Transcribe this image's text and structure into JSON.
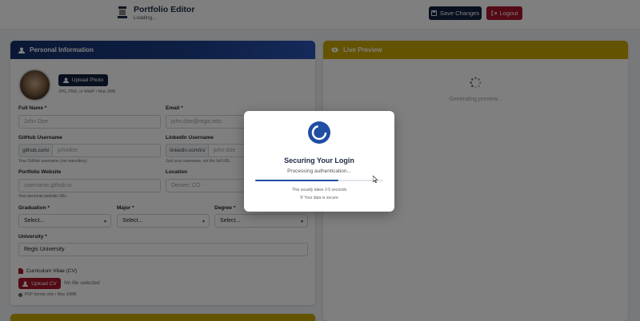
{
  "header": {
    "title": "Portfolio Editor",
    "subtitle": "Loading...",
    "save_label": "Save Changes",
    "logout_label": "Logout"
  },
  "personal": {
    "heading": "Personal Information",
    "upload_photo_label": "Upload Photo",
    "photo_hint": "JPG, PNG, or WebP • Max 2MB",
    "full_name": {
      "label": "Full Name *",
      "placeholder": "John Doe"
    },
    "email": {
      "label": "Email *",
      "placeholder": "john.doe@regis.edu"
    },
    "github": {
      "label": "GitHub Username",
      "prefix": "github.com/",
      "placeholder": "johndoe",
      "help": "Your GitHub username (not repository)"
    },
    "linkedin": {
      "label": "LinkedIn Username",
      "prefix": "linkedin.com/in/",
      "placeholder": "john-doe",
      "help": "Just your username, not the full URL"
    },
    "website": {
      "label": "Portfolio Website",
      "placeholder": "username.github.io",
      "help": "Your personal website URL"
    },
    "location": {
      "label": "Location",
      "placeholder": "Denver, CO"
    },
    "graduation": {
      "label": "Graduation *",
      "value": "Select..."
    },
    "major": {
      "label": "Major *",
      "value": "Select..."
    },
    "degree": {
      "label": "Degree *",
      "value": "Select..."
    },
    "university": {
      "label": "University *",
      "value": "Regis University"
    },
    "cv": {
      "label": "Curriculum Vitae (CV)",
      "button": "Upload CV",
      "status": "No file selected",
      "hint": "PDF format only • Max 10MB"
    }
  },
  "preview": {
    "heading": "Live Preview",
    "status": "Generating preview..."
  },
  "modal": {
    "title": "Securing Your Login",
    "status": "Processing authentication...",
    "progress": 0.65,
    "note": "This usually takes 2-5 seconds",
    "secure": "Your data is secure"
  },
  "colors": {
    "navy": "#12213f",
    "red": "#a8152a",
    "gold": "#c9a600",
    "blue": "#1f4ea3"
  }
}
